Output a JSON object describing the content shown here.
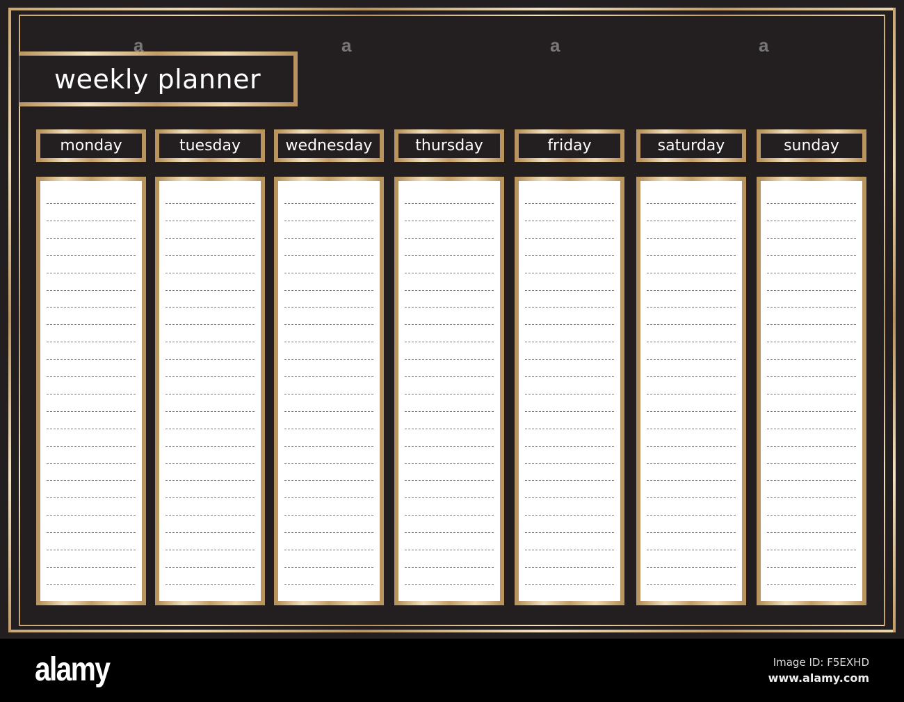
{
  "title": "weekly planner",
  "days": [
    {
      "label": "monday"
    },
    {
      "label": "tuesday"
    },
    {
      "label": "wednesday"
    },
    {
      "label": "thursday"
    },
    {
      "label": "friday"
    },
    {
      "label": "saturday"
    },
    {
      "label": "sunday"
    }
  ],
  "lines_per_day": 23,
  "colors": {
    "background": "#231f20",
    "gold": "#d8bb8a",
    "paper": "#ffffff",
    "text": "#ffffff"
  },
  "watermark": {
    "glyph": "a",
    "logo": "alamy",
    "image_id": "Image ID: F5EXHD",
    "url": "www.alamy.com"
  }
}
